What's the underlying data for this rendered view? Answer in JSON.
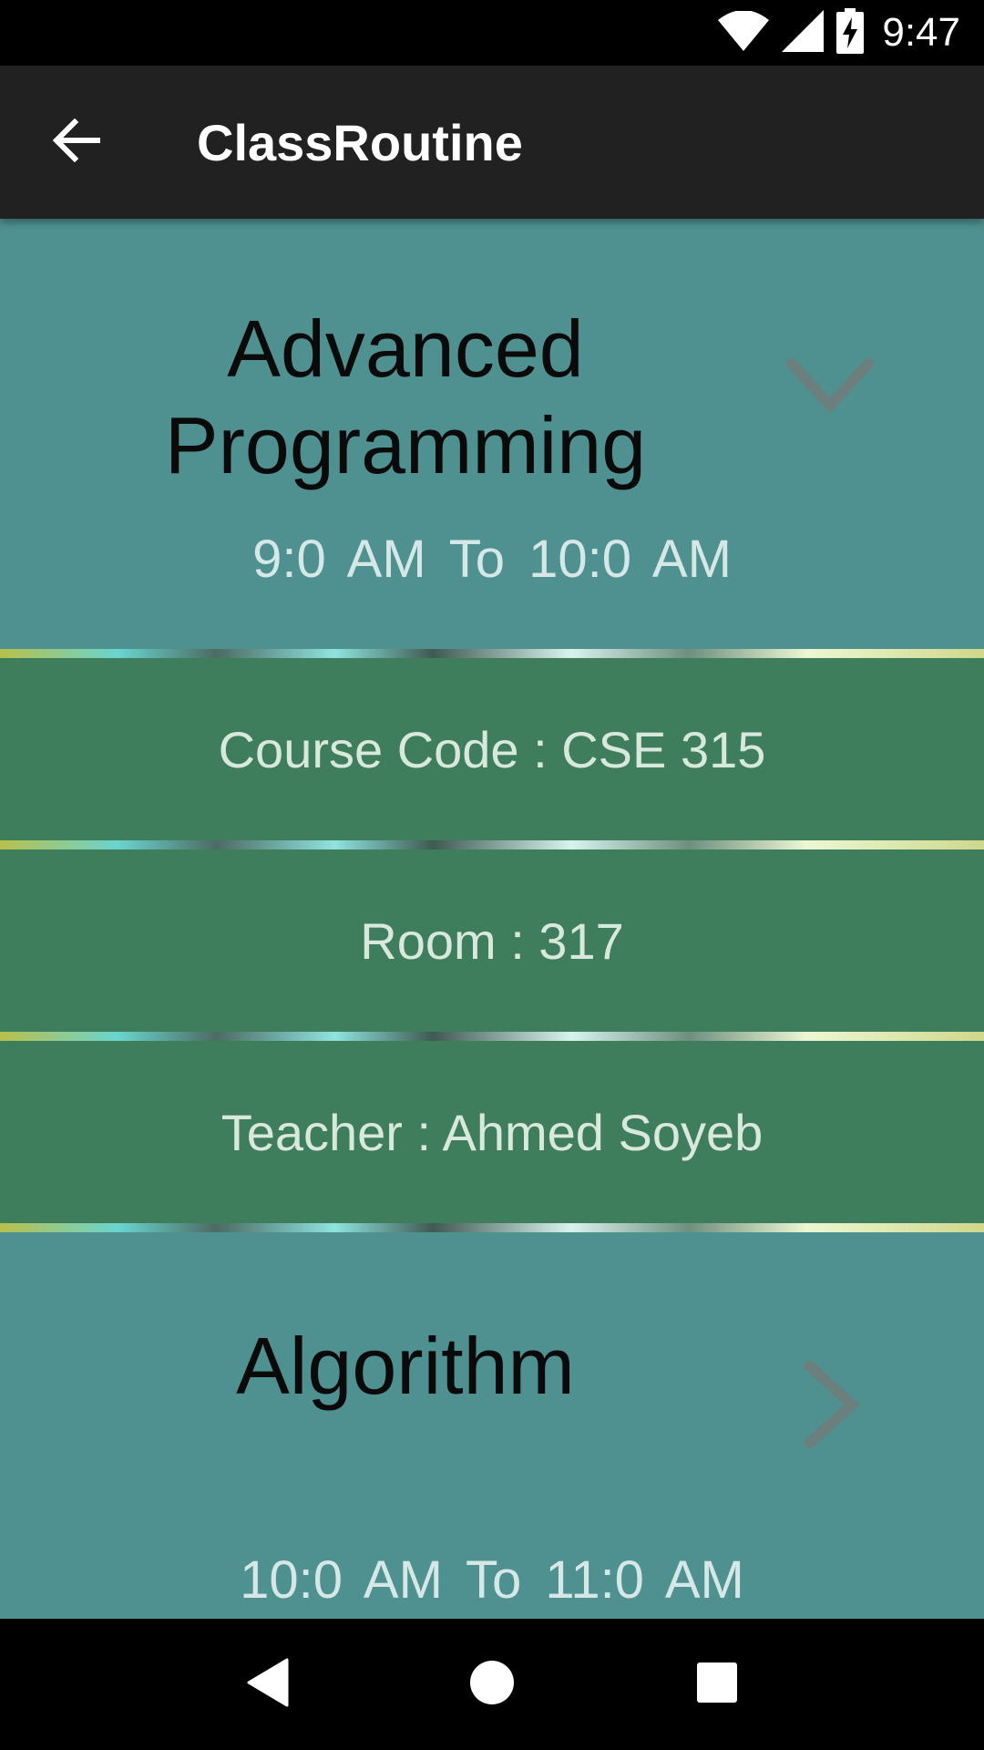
{
  "status_bar": {
    "time": "9:47",
    "icons": [
      "wifi-icon",
      "signal-icon",
      "battery-charging-icon"
    ]
  },
  "app_bar": {
    "title": "ClassRoutine",
    "back_icon": "arrow-left-icon"
  },
  "classes": [
    {
      "name": "Advanced Programming",
      "time_range": "9:0 AM  To  10:0 AM",
      "expanded": true,
      "indicator_icon": "chevron-down-icon",
      "details": {
        "course_code": "Course Code : CSE 315",
        "room": "Room : 317",
        "teacher": "Teacher : Ahmed Soyeb"
      }
    },
    {
      "name": "Algorithm",
      "time_range": "10:0 AM  To  11:0 AM",
      "expanded": false,
      "indicator_icon": "chevron-right-icon"
    }
  ],
  "nav_bar": {
    "icons": [
      "back-triangle-icon",
      "home-circle-icon",
      "recents-square-icon"
    ]
  },
  "colors": {
    "app_bar": "#212121",
    "group_background": "#4f9190",
    "child_background": "#3e7e5c",
    "title_text": "#0a0a0a",
    "secondary_text": "#d6e8e6"
  }
}
